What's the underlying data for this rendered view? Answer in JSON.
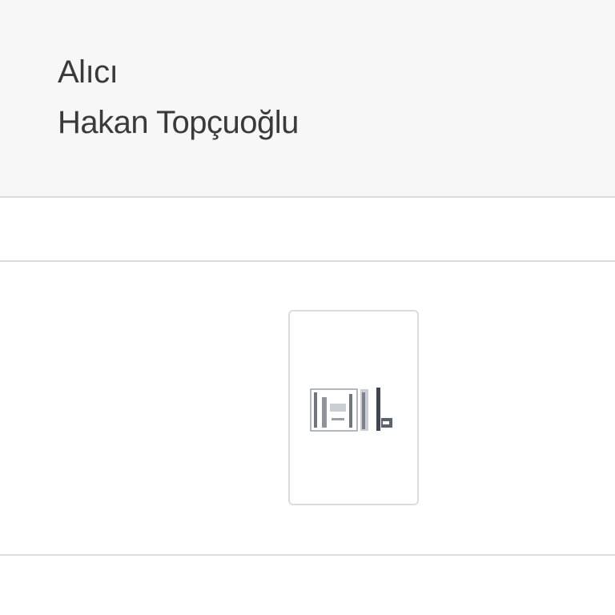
{
  "recipient": {
    "label": "Alıcı",
    "name": "Hakan Topçuoğlu"
  },
  "attachment": {
    "icon": "document-thumbnail-icon"
  },
  "colors": {
    "panel_background": "#f7f7f7",
    "text": "#3a3a3a",
    "divider": "#dcdcdc"
  }
}
